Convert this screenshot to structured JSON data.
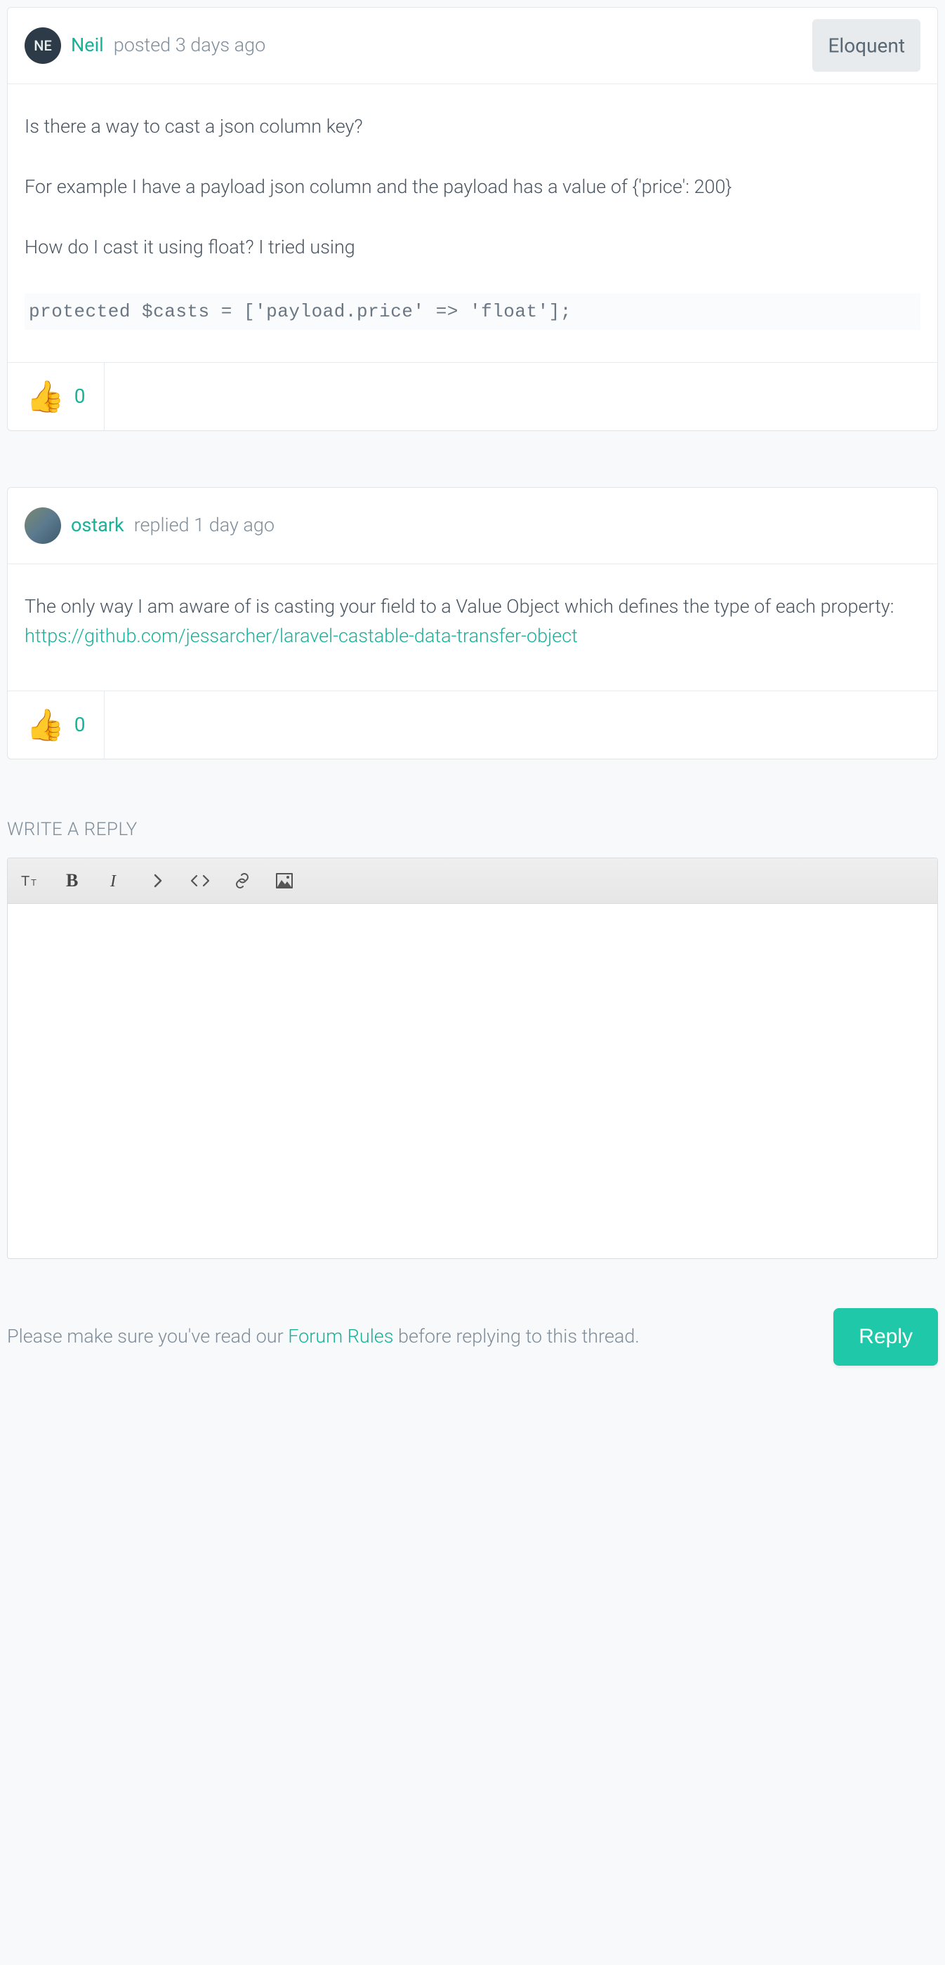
{
  "question": {
    "avatar_initials": "NE",
    "author": "Neil",
    "meta": "posted 3 days ago",
    "tag": "Eloquent",
    "body": {
      "p1": "Is there a way to cast a json column key?",
      "p2": "For example I have a payload json column and the payload has a value of {'price': 200}",
      "p3": "How do I cast it using float? I tried using",
      "code": "protected $casts = ['payload.price' => 'float'];"
    },
    "reaction_count": "0"
  },
  "reply": {
    "author": "ostark",
    "meta": "replied 1 day ago",
    "body_text": "The only way I am aware of is casting your field to a Value Object which defines the type of each property:",
    "link": "https://github.com/jessarcher/laravel-castable-data-transfer-object",
    "reaction_count": "0"
  },
  "compose": {
    "heading": "WRITE A REPLY",
    "rules_prefix": "Please make sure you've read our ",
    "rules_link": "Forum Rules",
    "rules_suffix": " before replying to this thread.",
    "button": "Reply"
  }
}
